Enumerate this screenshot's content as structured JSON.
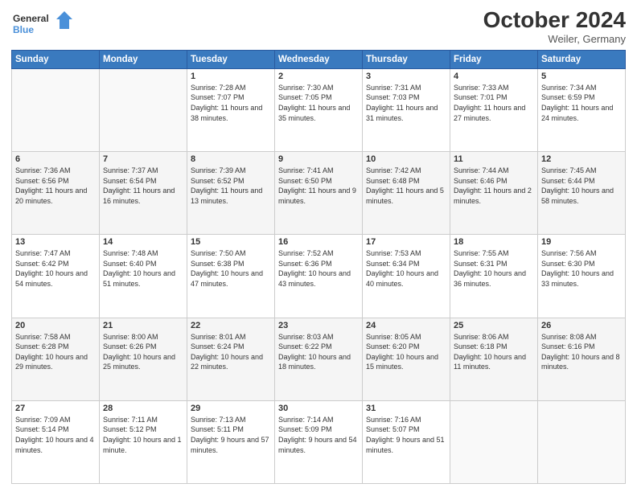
{
  "header": {
    "logo_general": "General",
    "logo_blue": "Blue",
    "month": "October 2024",
    "location": "Weiler, Germany"
  },
  "days_of_week": [
    "Sunday",
    "Monday",
    "Tuesday",
    "Wednesday",
    "Thursday",
    "Friday",
    "Saturday"
  ],
  "weeks": [
    [
      {
        "day": "",
        "content": ""
      },
      {
        "day": "",
        "content": ""
      },
      {
        "day": "1",
        "content": "Sunrise: 7:28 AM\nSunset: 7:07 PM\nDaylight: 11 hours and 38 minutes."
      },
      {
        "day": "2",
        "content": "Sunrise: 7:30 AM\nSunset: 7:05 PM\nDaylight: 11 hours and 35 minutes."
      },
      {
        "day": "3",
        "content": "Sunrise: 7:31 AM\nSunset: 7:03 PM\nDaylight: 11 hours and 31 minutes."
      },
      {
        "day": "4",
        "content": "Sunrise: 7:33 AM\nSunset: 7:01 PM\nDaylight: 11 hours and 27 minutes."
      },
      {
        "day": "5",
        "content": "Sunrise: 7:34 AM\nSunset: 6:59 PM\nDaylight: 11 hours and 24 minutes."
      }
    ],
    [
      {
        "day": "6",
        "content": "Sunrise: 7:36 AM\nSunset: 6:56 PM\nDaylight: 11 hours and 20 minutes."
      },
      {
        "day": "7",
        "content": "Sunrise: 7:37 AM\nSunset: 6:54 PM\nDaylight: 11 hours and 16 minutes."
      },
      {
        "day": "8",
        "content": "Sunrise: 7:39 AM\nSunset: 6:52 PM\nDaylight: 11 hours and 13 minutes."
      },
      {
        "day": "9",
        "content": "Sunrise: 7:41 AM\nSunset: 6:50 PM\nDaylight: 11 hours and 9 minutes."
      },
      {
        "day": "10",
        "content": "Sunrise: 7:42 AM\nSunset: 6:48 PM\nDaylight: 11 hours and 5 minutes."
      },
      {
        "day": "11",
        "content": "Sunrise: 7:44 AM\nSunset: 6:46 PM\nDaylight: 11 hours and 2 minutes."
      },
      {
        "day": "12",
        "content": "Sunrise: 7:45 AM\nSunset: 6:44 PM\nDaylight: 10 hours and 58 minutes."
      }
    ],
    [
      {
        "day": "13",
        "content": "Sunrise: 7:47 AM\nSunset: 6:42 PM\nDaylight: 10 hours and 54 minutes."
      },
      {
        "day": "14",
        "content": "Sunrise: 7:48 AM\nSunset: 6:40 PM\nDaylight: 10 hours and 51 minutes."
      },
      {
        "day": "15",
        "content": "Sunrise: 7:50 AM\nSunset: 6:38 PM\nDaylight: 10 hours and 47 minutes."
      },
      {
        "day": "16",
        "content": "Sunrise: 7:52 AM\nSunset: 6:36 PM\nDaylight: 10 hours and 43 minutes."
      },
      {
        "day": "17",
        "content": "Sunrise: 7:53 AM\nSunset: 6:34 PM\nDaylight: 10 hours and 40 minutes."
      },
      {
        "day": "18",
        "content": "Sunrise: 7:55 AM\nSunset: 6:31 PM\nDaylight: 10 hours and 36 minutes."
      },
      {
        "day": "19",
        "content": "Sunrise: 7:56 AM\nSunset: 6:30 PM\nDaylight: 10 hours and 33 minutes."
      }
    ],
    [
      {
        "day": "20",
        "content": "Sunrise: 7:58 AM\nSunset: 6:28 PM\nDaylight: 10 hours and 29 minutes."
      },
      {
        "day": "21",
        "content": "Sunrise: 8:00 AM\nSunset: 6:26 PM\nDaylight: 10 hours and 25 minutes."
      },
      {
        "day": "22",
        "content": "Sunrise: 8:01 AM\nSunset: 6:24 PM\nDaylight: 10 hours and 22 minutes."
      },
      {
        "day": "23",
        "content": "Sunrise: 8:03 AM\nSunset: 6:22 PM\nDaylight: 10 hours and 18 minutes."
      },
      {
        "day": "24",
        "content": "Sunrise: 8:05 AM\nSunset: 6:20 PM\nDaylight: 10 hours and 15 minutes."
      },
      {
        "day": "25",
        "content": "Sunrise: 8:06 AM\nSunset: 6:18 PM\nDaylight: 10 hours and 11 minutes."
      },
      {
        "day": "26",
        "content": "Sunrise: 8:08 AM\nSunset: 6:16 PM\nDaylight: 10 hours and 8 minutes."
      }
    ],
    [
      {
        "day": "27",
        "content": "Sunrise: 7:09 AM\nSunset: 5:14 PM\nDaylight: 10 hours and 4 minutes."
      },
      {
        "day": "28",
        "content": "Sunrise: 7:11 AM\nSunset: 5:12 PM\nDaylight: 10 hours and 1 minute."
      },
      {
        "day": "29",
        "content": "Sunrise: 7:13 AM\nSunset: 5:11 PM\nDaylight: 9 hours and 57 minutes."
      },
      {
        "day": "30",
        "content": "Sunrise: 7:14 AM\nSunset: 5:09 PM\nDaylight: 9 hours and 54 minutes."
      },
      {
        "day": "31",
        "content": "Sunrise: 7:16 AM\nSunset: 5:07 PM\nDaylight: 9 hours and 51 minutes."
      },
      {
        "day": "",
        "content": ""
      },
      {
        "day": "",
        "content": ""
      }
    ]
  ]
}
